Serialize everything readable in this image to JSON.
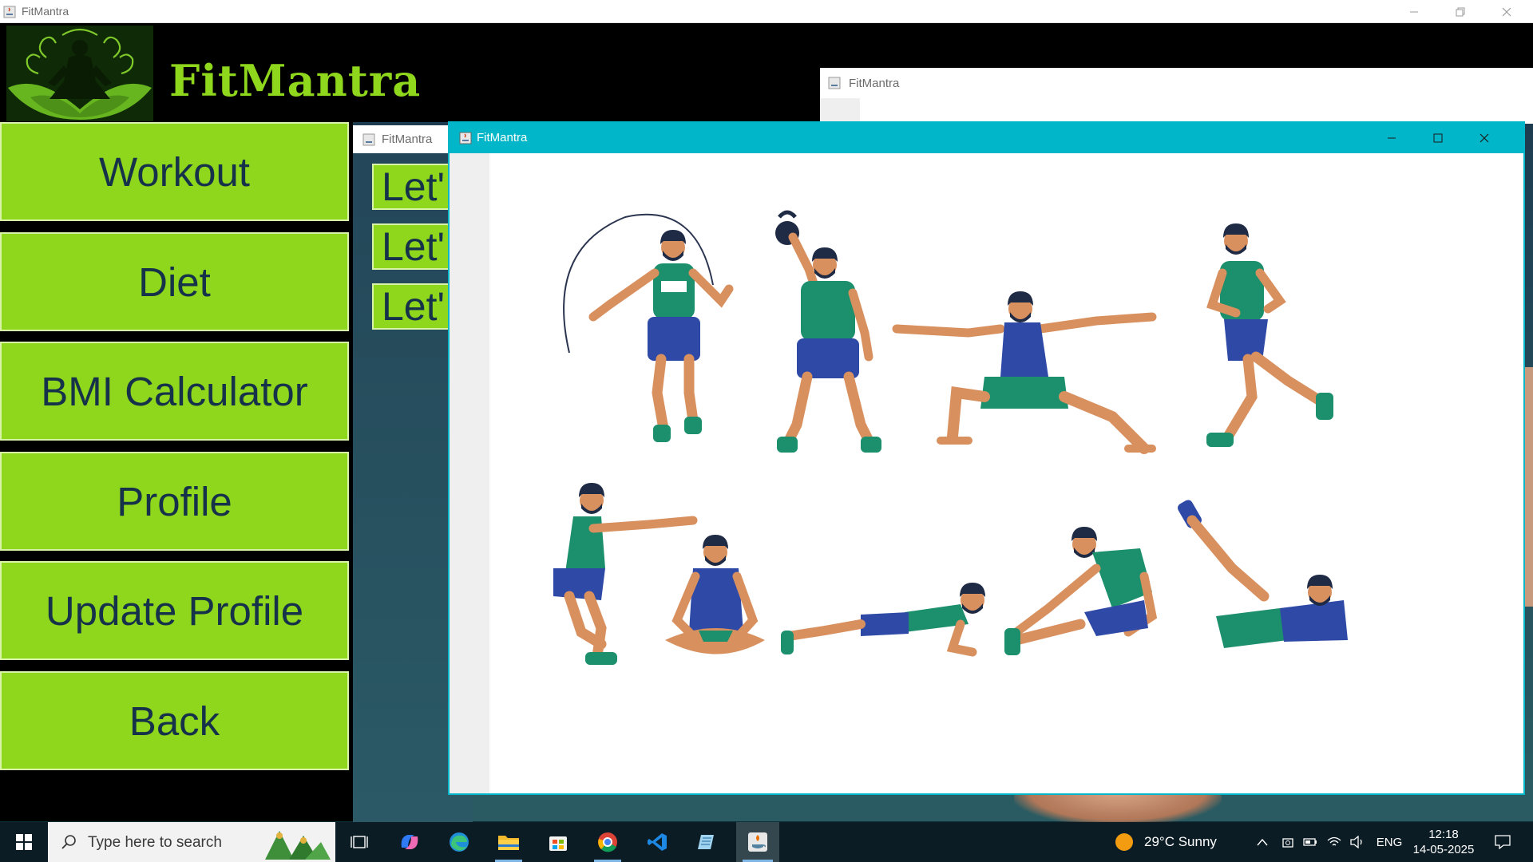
{
  "main_window": {
    "title": "FitMantra",
    "brand": "FitMantra"
  },
  "sidebar": {
    "items": [
      {
        "label": "Workout"
      },
      {
        "label": "Diet"
      },
      {
        "label": "BMI Calculator"
      },
      {
        "label": "Profile"
      },
      {
        "label": "Update Profile"
      },
      {
        "label": "Back"
      }
    ]
  },
  "middle_window": {
    "title": "FitMantra",
    "buttons": [
      {
        "label": "Let'"
      },
      {
        "label": "Let'"
      },
      {
        "label": "Let'"
      }
    ]
  },
  "right_window": {
    "title": "FitMantra"
  },
  "front_window": {
    "title": "FitMantra",
    "exercises": [
      "jump-rope",
      "kettlebell",
      "warrior-pose",
      "running",
      "squat",
      "meditation",
      "plank",
      "hamstring-stretch",
      "crunch"
    ]
  },
  "taskbar": {
    "search_placeholder": "Type here to search",
    "weather": "29°C  Sunny",
    "language": "ENG",
    "time": "12:18",
    "date": "14-05-2025"
  },
  "colors": {
    "accent_green": "#8fd71c",
    "text_navy": "#16324a",
    "titlebar_teal": "#00b6c8",
    "taskbar": "#0c1c24"
  }
}
